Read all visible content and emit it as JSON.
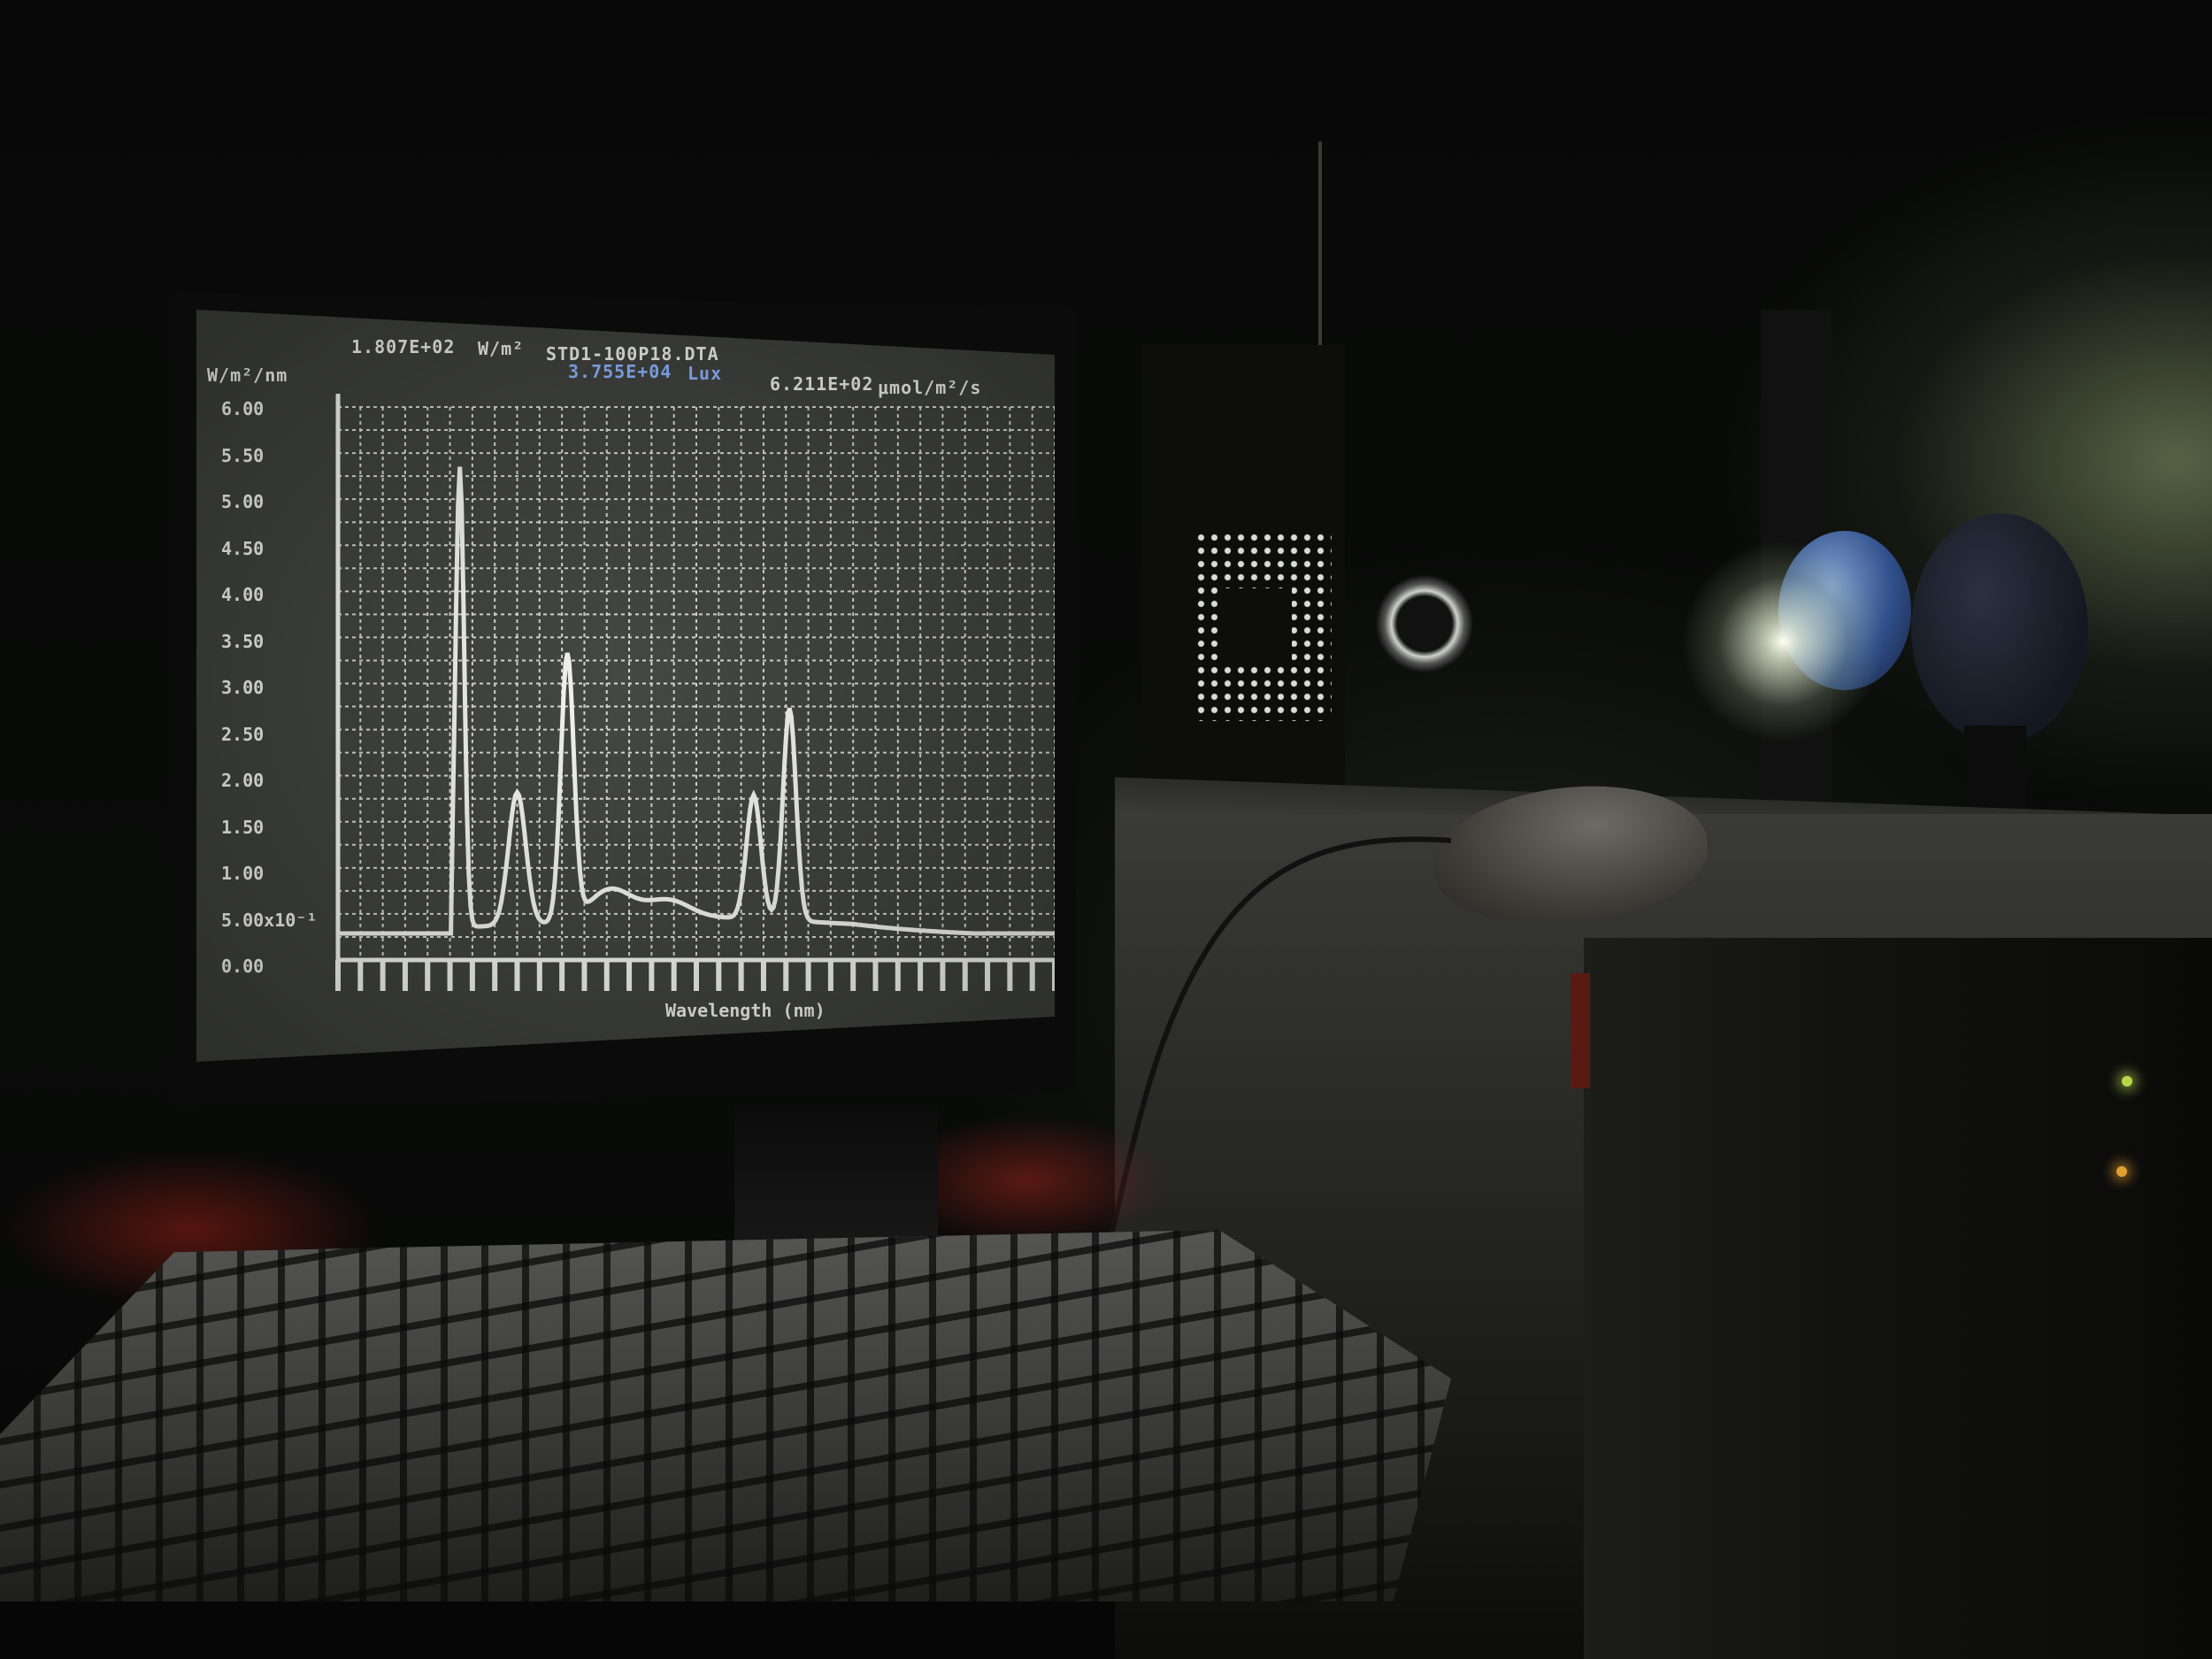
{
  "scene": "monitor-spectrum-photo",
  "screen": {
    "header_left_value": "1.807E+02",
    "header_left_unit": "W/m²",
    "file_name": "STD1-100P18.DTA",
    "lux_value": "3.755E+04",
    "lux_unit": "Lux",
    "photon_value": "6.211E+02",
    "photon_unit": "μmol/m²/s",
    "y_axis_unit": "W/m²/nm",
    "y_ticks": [
      "6.00",
      "5.50",
      "5.00",
      "4.50",
      "4.00",
      "3.50",
      "3.00",
      "2.50",
      "2.00",
      "1.50",
      "1.00",
      "5.00x10⁻¹",
      "0.00"
    ],
    "x_axis_label": "Wavelength (nm)"
  },
  "colors": {
    "screen_bg": "#3c3e3b",
    "trace": "#f4f4ee",
    "grid": "#d8d8d0",
    "lux_text": "#8ab4ff"
  }
}
